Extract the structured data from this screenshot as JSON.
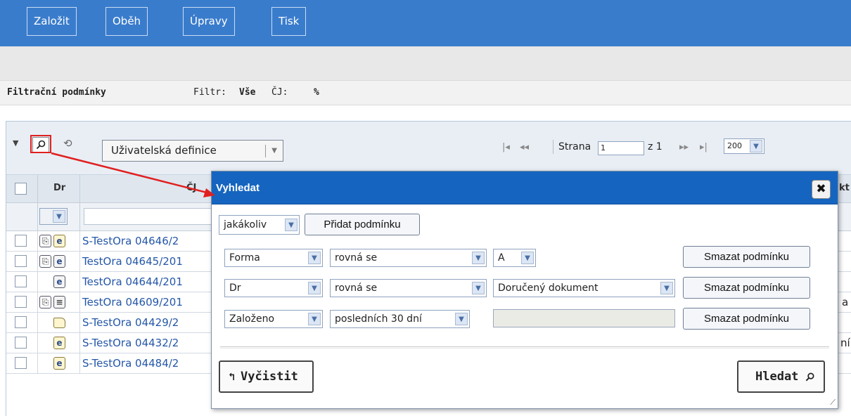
{
  "toolbar": {
    "buttons": [
      "Založit",
      "Oběh",
      "Úpravy",
      "Tisk"
    ]
  },
  "filter_bar": {
    "title": "Filtrační podmínky",
    "filter_label": "Filtr:",
    "filter_value": "Vše",
    "cj_label": "ČJ:",
    "cj_value": "%"
  },
  "grid": {
    "view_select": "Uživatelská definice",
    "pager": {
      "page_label": "Strana",
      "page_value": "1",
      "of_label": "z 1",
      "page_size": "200"
    },
    "columns": {
      "dr": "Dr",
      "cj": "ČJ",
      "right_partial": "kt"
    },
    "rows": [
      {
        "cj": "S-TestOra 04646/2",
        "extra": ""
      },
      {
        "cj": "TestOra 04645/201",
        "extra": ""
      },
      {
        "cj": "TestOra 04644/201",
        "extra": ""
      },
      {
        "cj": "TestOra 04609/201",
        "extra": "a"
      },
      {
        "cj": "S-TestOra 04429/2",
        "extra": ""
      },
      {
        "cj": "S-TestOra 04432/2",
        "extra": "ní"
      },
      {
        "cj": "S-TestOra 04484/2",
        "extra": ""
      }
    ]
  },
  "dialog": {
    "title": "Vyhledat",
    "match_mode": "jakákoliv",
    "add_condition": "Přidat podmínku",
    "conditions": [
      {
        "field": "Forma",
        "operator": "rovná se",
        "value": "A",
        "remove": "Smazat podmínku"
      },
      {
        "field": "Dr",
        "operator": "rovná se",
        "value": "Doručený dokument",
        "remove": "Smazat podmínku"
      },
      {
        "field": "Založeno",
        "operator": "posledních 30 dní",
        "value": "",
        "remove": "Smazat podmínku"
      }
    ],
    "clear_button": "Vyčistit",
    "search_button": "Hledat"
  },
  "colors": {
    "toolbar_bg": "#3a7ccc",
    "dialog_title_bg": "#1565c0",
    "link": "#2457a8",
    "annotation": "#e02020"
  }
}
